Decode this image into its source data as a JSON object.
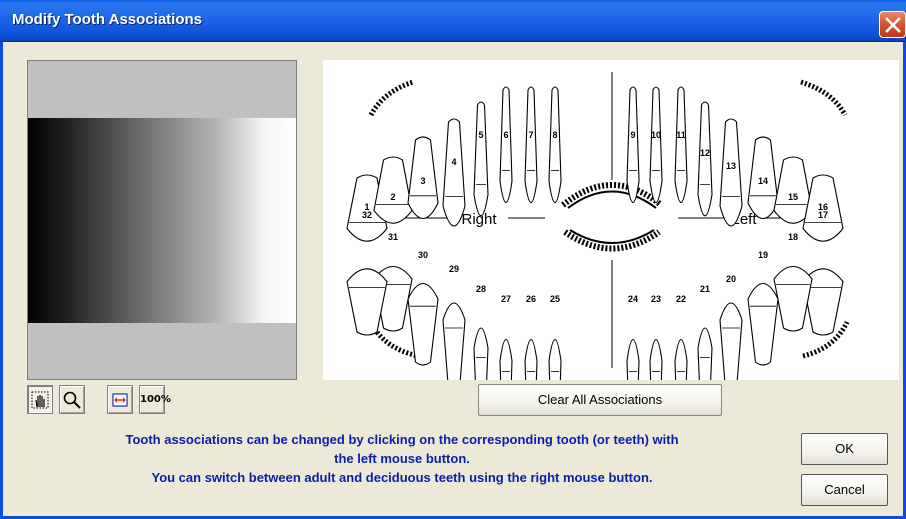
{
  "window": {
    "title": "Modify Tooth Associations"
  },
  "toolbar": {
    "hand_tool_icon": "hand-icon",
    "zoom_tool_icon": "magnifier-icon",
    "fit_width_icon": "fit-width-icon",
    "actual_size_label": "100%"
  },
  "chart": {
    "right_label": "Right",
    "left_label": "Left",
    "upper_teeth": [
      "1",
      "2",
      "3",
      "4",
      "5",
      "6",
      "7",
      "8",
      "9",
      "10",
      "11",
      "12",
      "13",
      "14",
      "15",
      "16"
    ],
    "lower_teeth": [
      "17",
      "18",
      "19",
      "20",
      "21",
      "22",
      "23",
      "24",
      "25",
      "26",
      "27",
      "28",
      "29",
      "30",
      "31",
      "32"
    ]
  },
  "buttons": {
    "clear_all": "Clear All Associations",
    "ok": "OK",
    "cancel": "Cancel"
  },
  "info": {
    "line1": "Tooth associations can be changed by clicking on the corresponding tooth (or teeth) with",
    "line2": "the left mouse button.",
    "line3": "You can switch between adult and deciduous teeth using the right mouse button."
  },
  "colors": {
    "title_bar": "#0d4fd4",
    "info_text": "#0a1fa8",
    "dialog_bg": "#ece9d8"
  }
}
